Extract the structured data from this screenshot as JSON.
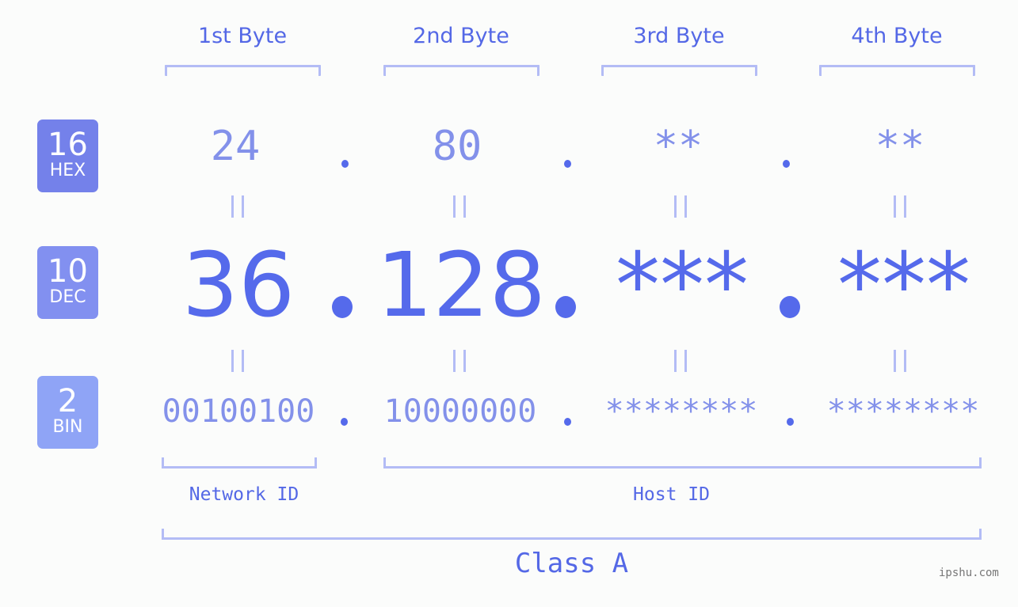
{
  "byte_headers": [
    "1st Byte",
    "2nd Byte",
    "3rd Byte",
    "4th Byte"
  ],
  "badges": {
    "hex": {
      "number": "16",
      "label": "HEX",
      "color": "#7481ea"
    },
    "dec": {
      "number": "10",
      "label": "DEC",
      "color": "#8290f0"
    },
    "bin": {
      "number": "2",
      "label": "BIN",
      "color": "#8fa4f6"
    }
  },
  "ip": {
    "hex": [
      "24",
      "80",
      "**",
      "**"
    ],
    "dec": [
      "36",
      "128",
      "***",
      "***"
    ],
    "bin": [
      "00100100",
      "10000000",
      "********",
      "********"
    ]
  },
  "labels": {
    "network_id": "Network ID",
    "host_id": "Host ID",
    "ip_class": "Class A"
  },
  "watermark": "ipshu.com",
  "colors": {
    "accent": "#556aeb",
    "muted_value": "#8391ea",
    "bracket": "#b3bcf5",
    "background": "#fbfcfb"
  }
}
